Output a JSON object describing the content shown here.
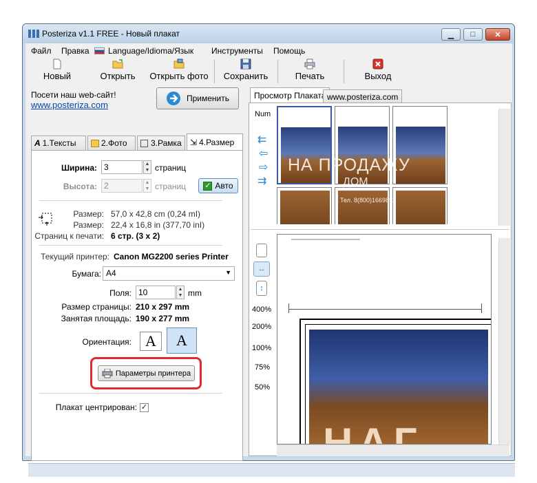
{
  "window": {
    "title": "Posteriza v1.1 FREE - Новый плакат"
  },
  "menu": {
    "items": [
      "Файл",
      "Правка",
      "Language/Idioma/Язык",
      "Инструменты",
      "Помощь"
    ]
  },
  "toolbar": {
    "new": "Новый",
    "open": "Открыть",
    "open_photo": "Открыть фото",
    "save": "Сохранить",
    "print": "Печать",
    "exit": "Выход"
  },
  "promo": {
    "text": "Посети наш web-сайт!",
    "link": "www.posteriza.com"
  },
  "apply_label": "Применить",
  "tabs": [
    "1.Тексты",
    "2.Фото",
    "3.Рамка",
    "4.Размер"
  ],
  "size": {
    "width_label": "Ширина:",
    "width_value": "3",
    "width_unit": "страниц",
    "height_label": "Высота:",
    "height_value": "2",
    "height_unit": "страниц",
    "auto_label": "Авто",
    "size1_label": "Размер:",
    "size1_value": "57,0 x 42,8 cm (0,24 mI)",
    "size2_label": "Размер:",
    "size2_value": "22,4 x 16,8 in (377,70 inI)",
    "pages_label": "Страниц к печати:",
    "pages_value": "6 стр. (3 x 2)"
  },
  "printer": {
    "current_label": "Текущий принтер:",
    "current_value": "Canon MG2200 series Printer",
    "paper_label": "Бумага:",
    "paper_value": "A4",
    "margins_label": "Поля:",
    "margins_value": "10",
    "margins_unit": "mm",
    "page_size_label": "Размер страницы:",
    "page_size_value": "210 x 297 mm",
    "area_label": "Занятая площадь:",
    "area_value": "190 x 277 mm",
    "orientation_label": "Ориентация:",
    "orientation_glyph": "A",
    "params_button": "Параметры принтера",
    "centered_label": "Плакат центрирован:"
  },
  "right_tabs": [
    "Просмотр Плаката",
    "www.posteriza.com"
  ],
  "preview": {
    "num_label": "Num",
    "poster_text": "НА ПРОДАЖУ",
    "poster_sub": "ДОМ",
    "poster_phone": "Тел. 8(800)1669893",
    "zoom_levels": [
      "400%",
      "200%",
      "100%",
      "75%",
      "50%"
    ],
    "big_text": "НАГ"
  },
  "colors": {
    "highlight": "#e02b2b",
    "accent": "#2a8ad4"
  }
}
